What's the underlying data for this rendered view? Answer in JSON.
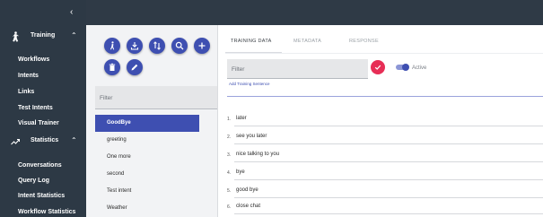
{
  "sidebar": {
    "sections": [
      {
        "label": "Training",
        "icon": "person-walking-icon"
      },
      {
        "label": "Statistics",
        "icon": "trending-up-icon"
      }
    ],
    "training_items": [
      "Workflows",
      "Intents",
      "Links",
      "Test Intents",
      "Visual Trainer"
    ],
    "statistics_items": [
      "Conversations",
      "Query Log",
      "Intent Statistics",
      "Workflow Statistics"
    ]
  },
  "toolbar": {
    "buttons": [
      "person-walking-icon",
      "download-icon",
      "sort-icon",
      "search-icon",
      "add-icon",
      "delete-icon",
      "edit-icon"
    ]
  },
  "intents": {
    "filter_placeholder": "Filter",
    "items": [
      "GoodBye",
      "greeting",
      "One more",
      "second",
      "Test intent",
      "Weather"
    ],
    "selected": "GoodBye"
  },
  "tabs": [
    "TRAINING DATA",
    "METADATA",
    "RESPONSE"
  ],
  "training": {
    "filter_placeholder": "Filter",
    "active_label": "Active",
    "active_on": true,
    "add_link": "Add Training Sentence",
    "sentences": [
      {
        "num": "1.",
        "text": "later"
      },
      {
        "num": "2.",
        "text": "see you later"
      },
      {
        "num": "3.",
        "text": "nice talking to you"
      },
      {
        "num": "4.",
        "text": "bye"
      },
      {
        "num": "5.",
        "text": "good bye"
      },
      {
        "num": "6.",
        "text": "close chat"
      }
    ]
  },
  "colors": {
    "sidebar": "#2d3945",
    "accent": "#3e4fb1",
    "confirm": "#e72e56"
  }
}
